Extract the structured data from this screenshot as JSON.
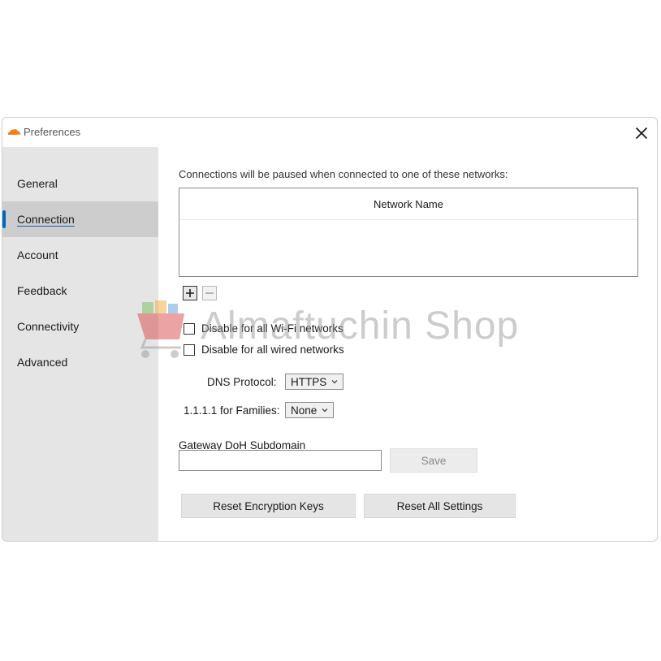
{
  "window": {
    "title": "Preferences",
    "close_icon": "close-icon",
    "logo_icon": "cloudflare-logo-icon"
  },
  "sidebar": {
    "items": [
      {
        "label": "General",
        "active": false
      },
      {
        "label": "Connection",
        "active": true
      },
      {
        "label": "Account",
        "active": false
      },
      {
        "label": "Feedback",
        "active": false
      },
      {
        "label": "Connectivity",
        "active": false
      },
      {
        "label": "Advanced",
        "active": false
      }
    ]
  },
  "connection": {
    "intro": "Connections will be paused when connected to one of these networks:",
    "network_table": {
      "header": "Network Name",
      "rows": []
    },
    "add_icon": "plus-icon",
    "remove_icon": "minus-icon",
    "checkboxes": [
      {
        "label": "Disable for all Wi-Fi networks",
        "checked": false
      },
      {
        "label": "Disable for all wired networks",
        "checked": false
      }
    ],
    "dns_protocol": {
      "label": "DNS Protocol:",
      "value": "HTTPS"
    },
    "families": {
      "label": "1.1.1.1 for Families:",
      "value": "None"
    },
    "gateway": {
      "label": "Gateway DoH Subdomain",
      "value": "",
      "placeholder": "",
      "save_label": "Save"
    },
    "reset_keys_label": "Reset Encryption Keys",
    "reset_all_label": "Reset All Settings"
  },
  "watermark": {
    "text": "Almaftuchin Shop"
  },
  "colors": {
    "accent": "#0067c0",
    "sidebar_bg": "#e5e5e5",
    "sidebar_active_bg": "#cdcdcd",
    "logo_orange": "#f38020"
  }
}
